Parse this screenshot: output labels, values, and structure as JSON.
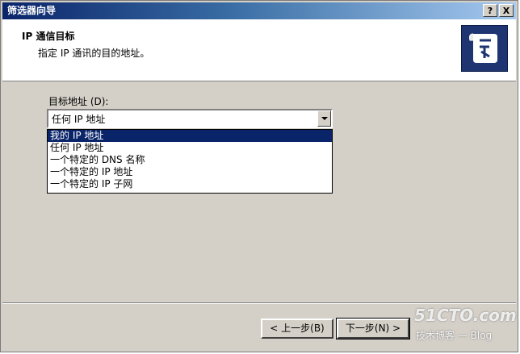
{
  "window": {
    "title": "筛选器向导",
    "help_button": "?",
    "close_button": "X"
  },
  "header": {
    "title": "IP 通信目标",
    "subtitle": "指定 IP 通讯的目的地址。"
  },
  "form": {
    "label": "目标地址 (D):",
    "selected_value": "任何 IP 地址",
    "options": [
      "我的 IP 地址",
      "任何 IP 地址",
      "一个特定的 DNS 名称",
      "一个特定的 IP 地址",
      "一个特定的 IP 子网"
    ],
    "highlighted_option": "我的 IP 地址"
  },
  "buttons": {
    "back": "< 上一步(B)",
    "next": "下一步(N) >"
  },
  "watermark": {
    "line1": "51CTO.com",
    "line2": "技术博客 — Blog"
  },
  "colors": {
    "title_start": "#0a246a",
    "title_end": "#a6caf0",
    "highlight": "#0a246a",
    "face": "#d4d0c8"
  },
  "icons": {
    "header_icon": "filter-wizard-icon",
    "combo_arrow": "chevron-down-icon"
  }
}
